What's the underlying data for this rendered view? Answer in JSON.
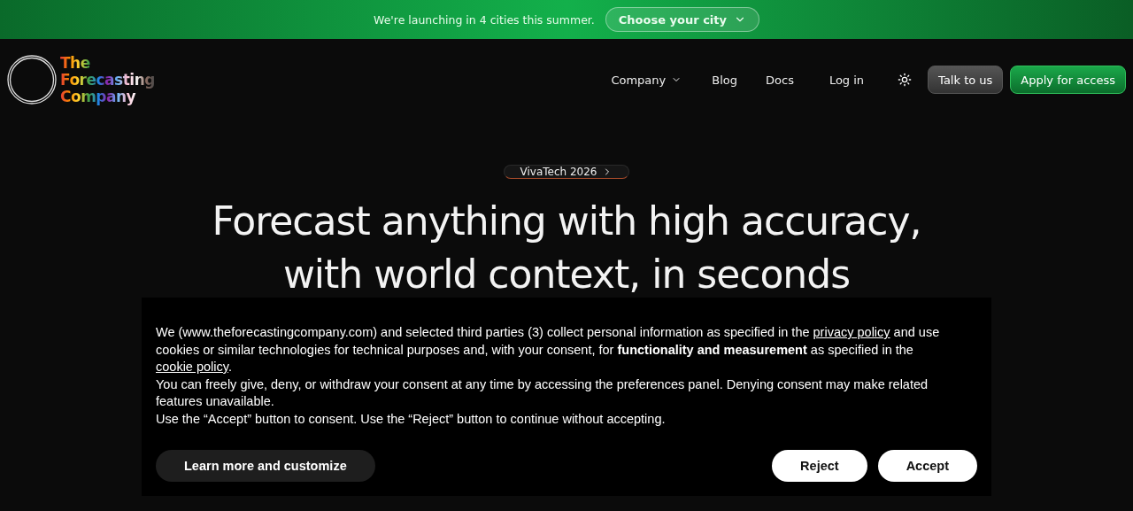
{
  "announcement": {
    "text": "We're launching in 4 cities this summer.",
    "button": "Choose your city"
  },
  "header": {
    "logo_lines": [
      "The",
      "Forecasting",
      "Company"
    ],
    "nav": [
      {
        "label": "Company",
        "kind": "dropdown"
      },
      {
        "label": "Blog",
        "kind": "link"
      },
      {
        "label": "Docs",
        "kind": "link"
      },
      {
        "label": "Log in",
        "kind": "link"
      }
    ],
    "buttons": [
      {
        "label": "Talk to us",
        "kind": "secondary"
      },
      {
        "label": "Apply for access",
        "kind": "primary"
      }
    ]
  },
  "hero": {
    "badge": "VivaTech 2026",
    "headline_lines": [
      "Forecast anything with high accuracy,",
      "with world context, in seconds"
    ]
  },
  "cookie_banner": {
    "paragraphs": [
      [
        {
          "kind": "text",
          "text": "We (www.theforecastingcompany.com) and selected third parties (3) collect personal information as specified in the "
        },
        {
          "kind": "link",
          "text": "privacy policy"
        },
        {
          "kind": "text",
          "text": " and use cookies or similar technologies for technical purposes and, with your consent, for **functionality and measurement** as specified in the "
        },
        {
          "kind": "link",
          "text": "cookie policy"
        },
        {
          "kind": "text",
          "text": "."
        }
      ],
      [
        {
          "kind": "text",
          "text": "You can freely give, deny, or withdraw your consent at any time by accessing the preferences panel. Denying consent may make related features unavailable."
        }
      ],
      [
        {
          "kind": "text",
          "text": "Use the “Accept” button to consent. Use the “Reject” button to continue without accepting."
        }
      ]
    ],
    "buttons": [
      {
        "label": "Learn more and customize",
        "kind": "dark"
      },
      {
        "label": "Reject",
        "kind": "light"
      },
      {
        "label": "Accept",
        "kind": "light"
      }
    ]
  }
}
